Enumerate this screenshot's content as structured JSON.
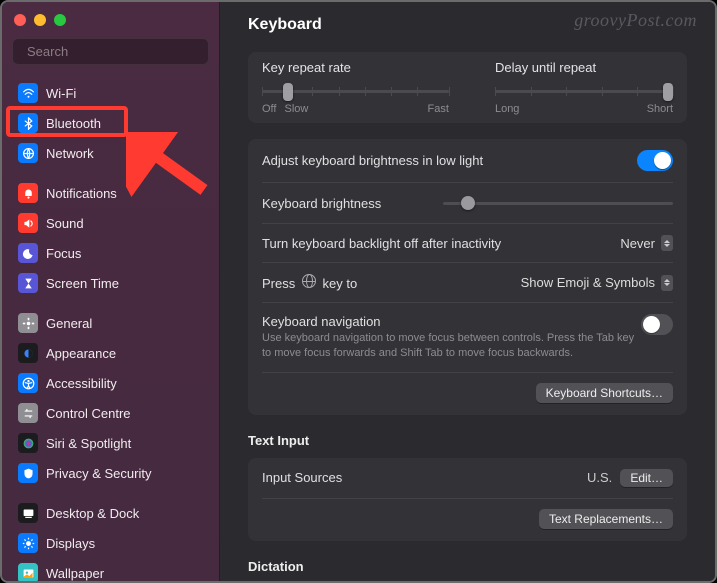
{
  "watermark": "groovyPost.com",
  "search": {
    "placeholder": "Search"
  },
  "sidebar": {
    "groups": [
      [
        {
          "label": "Wi-Fi",
          "icon": "wifi",
          "color": "#0a7aff"
        },
        {
          "label": "Bluetooth",
          "icon": "bluetooth",
          "color": "#0a7aff"
        },
        {
          "label": "Network",
          "icon": "network",
          "color": "#0a7aff"
        }
      ],
      [
        {
          "label": "Notifications",
          "icon": "bell",
          "color": "#ff3b30"
        },
        {
          "label": "Sound",
          "icon": "sound",
          "color": "#ff3b30"
        },
        {
          "label": "Focus",
          "icon": "focus",
          "color": "#5856d6"
        },
        {
          "label": "Screen Time",
          "icon": "hourglass",
          "color": "#5856d6"
        }
      ],
      [
        {
          "label": "General",
          "icon": "gear",
          "color": "#8e8e93"
        },
        {
          "label": "Appearance",
          "icon": "appearance",
          "color": "#1c1c1e"
        },
        {
          "label": "Accessibility",
          "icon": "accessibility",
          "color": "#0a7aff"
        },
        {
          "label": "Control Centre",
          "icon": "control",
          "color": "#8e8e93"
        },
        {
          "label": "Siri & Spotlight",
          "icon": "siri",
          "color": "#1c1c1e"
        },
        {
          "label": "Privacy & Security",
          "icon": "privacy",
          "color": "#0a7aff"
        }
      ],
      [
        {
          "label": "Desktop & Dock",
          "icon": "dock",
          "color": "#1c1c1e"
        },
        {
          "label": "Displays",
          "icon": "displays",
          "color": "#0a7aff"
        },
        {
          "label": "Wallpaper",
          "icon": "wallpaper",
          "color": "#34c2c5"
        }
      ]
    ]
  },
  "main": {
    "title": "Keyboard",
    "repeat": {
      "rate_label": "Key repeat rate",
      "rate_left": "Off",
      "rate_left2": "Slow",
      "rate_right": "Fast",
      "delay_label": "Delay until repeat",
      "delay_left": "Long",
      "delay_right": "Short"
    },
    "brightness_low_light": "Adjust keyboard brightness in low light",
    "brightness_label": "Keyboard brightness",
    "backlight_off_label": "Turn keyboard backlight off after inactivity",
    "backlight_off_value": "Never",
    "globe_label_pre": "Press",
    "globe_label_post": "key to",
    "globe_value": "Show Emoji & Symbols",
    "nav_label": "Keyboard navigation",
    "nav_desc": "Use keyboard navigation to move focus between controls. Press the Tab key to move focus forwards and Shift Tab to move focus backwards.",
    "shortcuts_btn": "Keyboard Shortcuts…",
    "text_input_title": "Text Input",
    "input_sources_label": "Input Sources",
    "input_sources_value": "U.S.",
    "edit_btn": "Edit…",
    "replacements_btn": "Text Replacements…",
    "dictation_title": "Dictation"
  }
}
